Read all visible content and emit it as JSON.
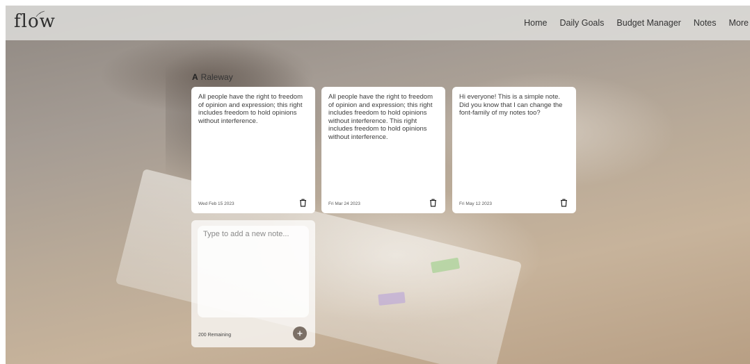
{
  "logo": {
    "text": "flow"
  },
  "nav": {
    "items": [
      {
        "label": "Home"
      },
      {
        "label": "Daily Goals"
      },
      {
        "label": "Budget Manager"
      },
      {
        "label": "Notes"
      },
      {
        "label": "More"
      }
    ]
  },
  "font_selector": {
    "icon_letter": "A",
    "font_name": "Raleway"
  },
  "notes": [
    {
      "text": "All people have the right to freedom of opinion and expression; this right includes freedom to hold opinions without interference.",
      "date": "Wed Feb 15 2023"
    },
    {
      "text": "All people have the right to freedom of opinion and expression; this right includes freedom to hold opinions without interference. This right includes freedom to hold opinions without interference.",
      "date": "Fri Mar 24 2023"
    },
    {
      "text": "Hi everyone! This is a simple note. Did you know that I can change the font-family of my notes too?",
      "date": "Fri May 12 2023"
    }
  ],
  "new_note": {
    "placeholder": "Type to add a new note...",
    "remaining_text": "200 Remaining"
  },
  "icons": {
    "delete": "trash-icon",
    "add": "plus-icon",
    "logo_leaf": "leaf-icon"
  },
  "colors": {
    "nav_background": "#e1e0de",
    "card_background": "#ffffff",
    "add_button": "#7b6f66"
  }
}
